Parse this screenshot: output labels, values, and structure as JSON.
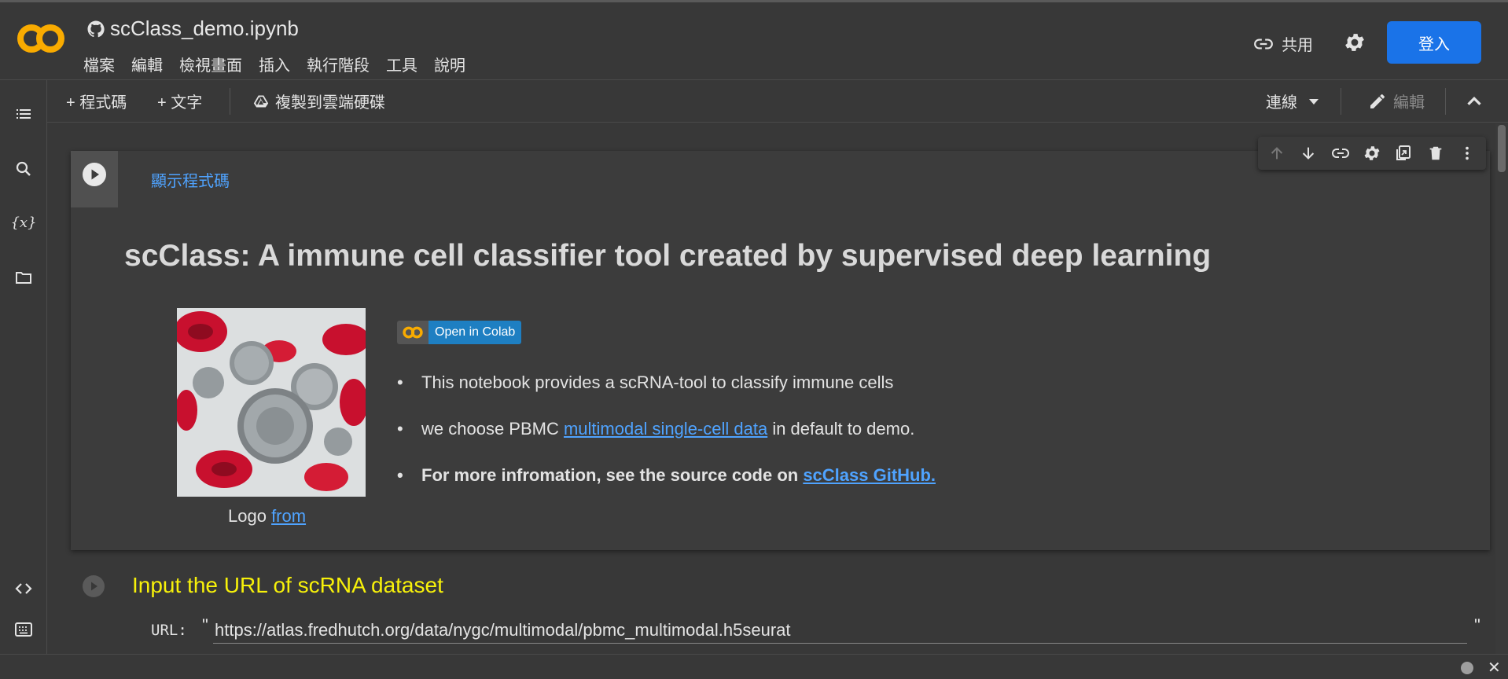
{
  "header": {
    "notebook_name": "scClass_demo.ipynb",
    "menu": [
      "檔案",
      "編輯",
      "檢視畫面",
      "插入",
      "執行階段",
      "工具",
      "說明"
    ],
    "share_label": "共用",
    "login_label": "登入"
  },
  "toolbar": {
    "add_code": "+ 程式碼",
    "add_text": "+ 文字",
    "copy_to_drive": "複製到雲端硬碟",
    "connect": "連線",
    "edit": "編輯"
  },
  "cell1": {
    "show_code": "顯示程式碼",
    "heading": "scClass: A immune cell classifier tool created by supervised deep learning",
    "badge_text": "Open in Colab",
    "bullet1": "This notebook provides a scRNA-tool to classify immune cells",
    "bullet2_pre": "we choose PBMC ",
    "bullet2_link": "multimodal single-cell data",
    "bullet2_post": " in default to demo.",
    "bullet3_pre": "For more infromation, see the source code on ",
    "bullet3_link": "scClass GitHub.",
    "caption_pre": "Logo ",
    "caption_link": "from"
  },
  "cell2": {
    "title": "Input the URL of scRNA dataset",
    "url_label": "URL:",
    "url_value": "https://atlas.fredhutch.org/data/nygc/multimodal/pbmc_multimodal.h5seurat",
    "quote": "\""
  },
  "colors": {
    "accent": "#1a73e8",
    "link": "#4fa3ff",
    "form_title": "#f7f10a",
    "background": "#383838"
  }
}
